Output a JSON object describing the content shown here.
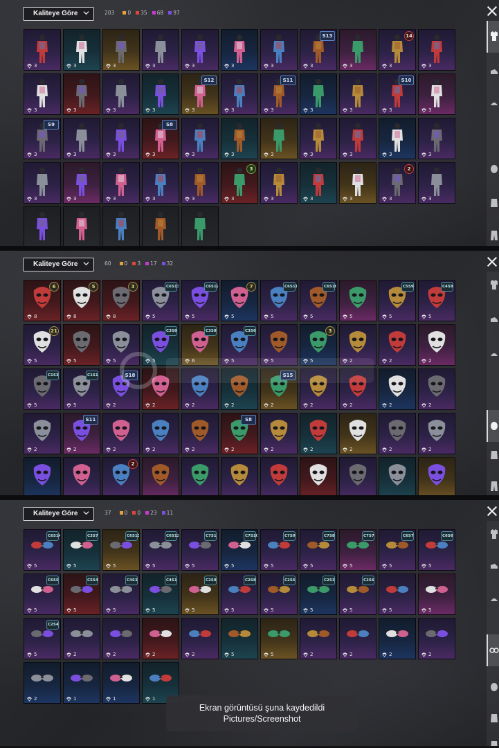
{
  "panels": [
    {
      "sort_label": "Kaliteye Göre",
      "total": "203",
      "counts": [
        {
          "value": "0",
          "color": "#e8a23a"
        },
        {
          "value": "35",
          "color": "#e0443a"
        },
        {
          "value": "68",
          "color": "#c43bd1"
        },
        {
          "value": "97",
          "color": "#7a4fe0"
        }
      ]
    },
    {
      "sort_label": "Kaliteye Göre",
      "total": "60",
      "counts": [
        {
          "value": "0",
          "color": "#e8a23a"
        },
        {
          "value": "3",
          "color": "#e0443a"
        },
        {
          "value": "17",
          "color": "#c43bd1"
        },
        {
          "value": "32",
          "color": "#7a4fe0"
        }
      ]
    },
    {
      "sort_label": "Kaliteye Göre",
      "total": "37",
      "counts": [
        {
          "value": "0",
          "color": "#e8a23a"
        },
        {
          "value": "0",
          "color": "#e0443a"
        },
        {
          "value": "23",
          "color": "#c43bd1"
        },
        {
          "value": "11",
          "color": "#7a4fe0"
        }
      ]
    }
  ],
  "panel1_items": [
    {
      "count": "3",
      "badge": ""
    },
    {
      "count": "3",
      "badge": ""
    },
    {
      "count": "3",
      "badge": ""
    },
    {
      "count": "3",
      "badge": ""
    },
    {
      "count": "3",
      "badge": ""
    },
    {
      "count": "3",
      "badge": ""
    },
    {
      "count": "3",
      "badge": ""
    },
    {
      "count": "3",
      "badge": "S13"
    },
    {
      "count": "3",
      "badge": ""
    },
    {
      "count": "3",
      "badge": "14"
    },
    {
      "count": "3",
      "badge": ""
    },
    {
      "count": "3",
      "badge": ""
    },
    {
      "count": "3",
      "badge": ""
    },
    {
      "count": "3",
      "badge": ""
    },
    {
      "count": "3",
      "badge": ""
    },
    {
      "count": "3",
      "badge": "S12"
    },
    {
      "count": "3",
      "badge": ""
    },
    {
      "count": "3",
      "badge": "S11"
    },
    {
      "count": "3",
      "badge": ""
    },
    {
      "count": "3",
      "badge": ""
    },
    {
      "count": "3",
      "badge": "S10"
    },
    {
      "count": "3",
      "badge": ""
    },
    {
      "count": "3",
      "badge": "S9"
    },
    {
      "count": "3",
      "badge": ""
    },
    {
      "count": "3",
      "badge": ""
    },
    {
      "count": "3",
      "badge": "S8"
    },
    {
      "count": "3",
      "badge": ""
    },
    {
      "count": "3",
      "badge": ""
    },
    {
      "count": "3",
      "badge": ""
    },
    {
      "count": "3",
      "badge": ""
    },
    {
      "count": "3",
      "badge": ""
    },
    {
      "count": "3",
      "badge": ""
    },
    {
      "count": "3",
      "badge": ""
    },
    {
      "count": "3",
      "badge": ""
    },
    {
      "count": "3",
      "badge": ""
    },
    {
      "count": "3",
      "badge": ""
    },
    {
      "count": "3",
      "badge": ""
    },
    {
      "count": "3",
      "badge": ""
    },
    {
      "count": "3",
      "badge": "3"
    },
    {
      "count": "3",
      "badge": ""
    },
    {
      "count": "3",
      "badge": ""
    },
    {
      "count": "3",
      "badge": ""
    },
    {
      "count": "3",
      "badge": "2"
    },
    {
      "count": "3",
      "badge": ""
    },
    {
      "count": "",
      "badge": ""
    },
    {
      "count": "",
      "badge": ""
    },
    {
      "count": "",
      "badge": ""
    },
    {
      "count": "",
      "badge": ""
    },
    {
      "count": "",
      "badge": ""
    }
  ],
  "panel2_items": [
    {
      "count": "8",
      "badge": "6"
    },
    {
      "count": "8",
      "badge": "5"
    },
    {
      "count": "8",
      "badge": "3"
    },
    {
      "count": "5",
      "badge": "C6S13"
    },
    {
      "count": "5",
      "badge": "C6S12"
    },
    {
      "count": "5",
      "badge": "7"
    },
    {
      "count": "5",
      "badge": "C6S11"
    },
    {
      "count": "5",
      "badge": "C6S10"
    },
    {
      "count": "5",
      "badge": ""
    },
    {
      "count": "5",
      "badge": "C5S9"
    },
    {
      "count": "5",
      "badge": "C4S9"
    },
    {
      "count": "5",
      "badge": "21"
    },
    {
      "count": "5",
      "badge": ""
    },
    {
      "count": "5",
      "badge": ""
    },
    {
      "count": "5",
      "badge": "C3S8"
    },
    {
      "count": "6",
      "badge": "C3S8"
    },
    {
      "count": "5",
      "badge": "C3S6"
    },
    {
      "count": "5",
      "badge": ""
    },
    {
      "count": "5",
      "badge": "3"
    },
    {
      "count": "2",
      "badge": ""
    },
    {
      "count": "2",
      "badge": ""
    },
    {
      "count": "2",
      "badge": ""
    },
    {
      "count": "5",
      "badge": "C1S3"
    },
    {
      "count": "5",
      "badge": "C1S1"
    },
    {
      "count": "2",
      "badge": "S18"
    },
    {
      "count": "2",
      "badge": ""
    },
    {
      "count": "2",
      "badge": ""
    },
    {
      "count": "2",
      "badge": ""
    },
    {
      "count": "2",
      "badge": "S15"
    },
    {
      "count": "2",
      "badge": ""
    },
    {
      "count": "2",
      "badge": ""
    },
    {
      "count": "2",
      "badge": ""
    },
    {
      "count": "2",
      "badge": ""
    },
    {
      "count": "2",
      "badge": ""
    },
    {
      "count": "2",
      "badge": "S11"
    },
    {
      "count": "2",
      "badge": ""
    },
    {
      "count": "2",
      "badge": ""
    },
    {
      "count": "2",
      "badge": ""
    },
    {
      "count": "2",
      "badge": "S8"
    },
    {
      "count": "2",
      "badge": ""
    },
    {
      "count": "2",
      "badge": ""
    },
    {
      "count": "2",
      "badge": ""
    },
    {
      "count": "2",
      "badge": ""
    },
    {
      "count": "2",
      "badge": ""
    },
    {
      "count": "",
      "badge": ""
    },
    {
      "count": "",
      "badge": ""
    },
    {
      "count": "",
      "badge": "2"
    },
    {
      "count": "",
      "badge": ""
    },
    {
      "count": "",
      "badge": ""
    },
    {
      "count": "",
      "badge": ""
    },
    {
      "count": "",
      "badge": ""
    },
    {
      "count": "",
      "badge": ""
    },
    {
      "count": "",
      "badge": ""
    },
    {
      "count": "",
      "badge": ""
    },
    {
      "count": "",
      "badge": ""
    }
  ],
  "panel3_items": [
    {
      "count": "5",
      "badge": "C6S14"
    },
    {
      "count": "5",
      "badge": "C3S7"
    },
    {
      "count": "5",
      "badge": "C6S13"
    },
    {
      "count": "5",
      "badge": "C6S12"
    },
    {
      "count": "5",
      "badge": "C7S1"
    },
    {
      "count": "5",
      "badge": "C7S10"
    },
    {
      "count": "5",
      "badge": "C7S9"
    },
    {
      "count": "5",
      "badge": "C7S8"
    },
    {
      "count": "5",
      "badge": "C7S7"
    },
    {
      "count": "5",
      "badge": "C6S7"
    },
    {
      "count": "5",
      "badge": "C6S6"
    },
    {
      "count": "5",
      "badge": "C6S5"
    },
    {
      "count": "5",
      "badge": "C5S4"
    },
    {
      "count": "5",
      "badge": "C4S3"
    },
    {
      "count": "5",
      "badge": "C4S1"
    },
    {
      "count": "5",
      "badge": "C2S8"
    },
    {
      "count": "5",
      "badge": "C2S8"
    },
    {
      "count": "5",
      "badge": "C2S6"
    },
    {
      "count": "5",
      "badge": "C2S3"
    },
    {
      "count": "5",
      "badge": "C2S6"
    },
    {
      "count": "5",
      "badge": ""
    },
    {
      "count": "5",
      "badge": ""
    },
    {
      "count": "5",
      "badge": "C2S4"
    },
    {
      "count": "2",
      "badge": ""
    },
    {
      "count": "2",
      "badge": ""
    },
    {
      "count": "2",
      "badge": ""
    },
    {
      "count": "2",
      "badge": ""
    },
    {
      "count": "5",
      "badge": ""
    },
    {
      "count": "5",
      "badge": ""
    },
    {
      "count": "2",
      "badge": ""
    },
    {
      "count": "2",
      "badge": ""
    },
    {
      "count": "2",
      "badge": ""
    },
    {
      "count": "2",
      "badge": ""
    },
    {
      "count": "2",
      "badge": ""
    },
    {
      "count": "1",
      "badge": ""
    },
    {
      "count": "1",
      "badge": ""
    },
    {
      "count": "1",
      "badge": ""
    }
  ],
  "toast": {
    "line1": "Ekran görüntüsü şuna kaydedildi",
    "line2": "Pictures/Screenshot"
  },
  "icons": {
    "sort_chevron": "chevron-down-icon",
    "close": "close-icon",
    "count_prefix": "parachute-icon",
    "tabs": [
      "outfit-icon",
      "shoes-icon",
      "hat-icon",
      "mask-icon",
      "jacket-icon",
      "pants-icon"
    ]
  }
}
